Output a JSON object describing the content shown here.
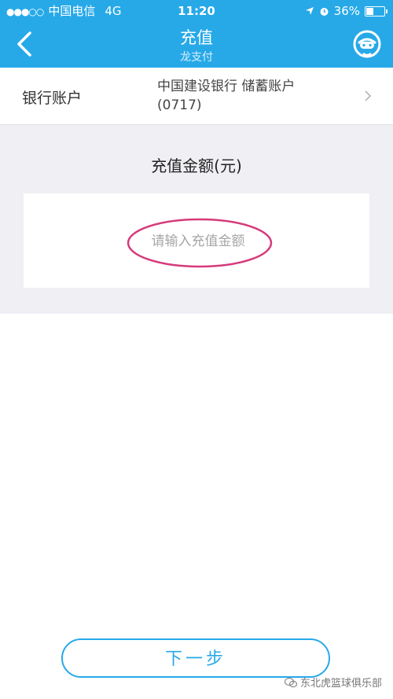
{
  "status_bar": {
    "signal": "●●●○○",
    "carrier": "中国电信",
    "network": "4G",
    "time": "11:20",
    "battery": "36%"
  },
  "header": {
    "title": "充值",
    "subtitle": "龙支付",
    "icons": {
      "back": "chevron-left-icon",
      "support": "customer-service-icon"
    }
  },
  "account": {
    "label": "银行账户",
    "value_line1": "中国建设银行 储蓄账户",
    "value_line2": "(0717)"
  },
  "amount": {
    "title": "充值金额(元)",
    "placeholder": "请输入充值金额"
  },
  "next_button": {
    "label": "下一步"
  },
  "watermark": {
    "text": "东北虎篮球俱乐部"
  },
  "colors": {
    "primary": "#27a9e8",
    "section_bg": "#efeff4",
    "highlight": "#d63a7a"
  }
}
